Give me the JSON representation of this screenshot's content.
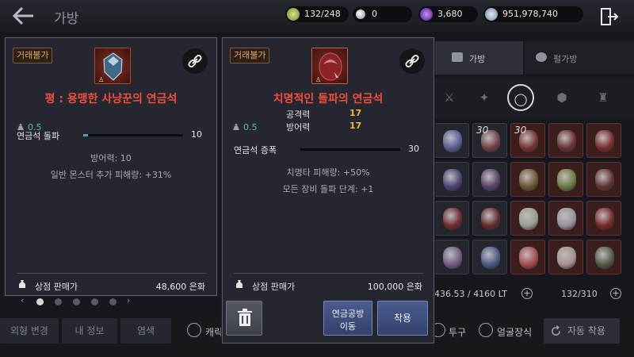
{
  "header": {
    "title": "가방",
    "currencies": {
      "weight": "132/248",
      "pearls": "0",
      "crystals": "3,680",
      "silver": "951,978,740"
    }
  },
  "background": {
    "tabs": [
      {
        "label": "가방"
      },
      {
        "label": "펄가방"
      }
    ],
    "category_icons": [
      "crossed-swords",
      "armor",
      "ring",
      "shield",
      "alchemy-stone-flask"
    ],
    "grid": {
      "stack_counts": [
        "30",
        "30"
      ],
      "gem_colors": [
        "#6c6fb8",
        "#8a4a4a",
        "#8e3a3a",
        "#7a3a3a",
        "#8c3232",
        "#5b4a8a",
        "#6a4a7a",
        "#7a6a3a",
        "#7a9a4a",
        "#6a3a3a",
        "#8a2e2e",
        "#7a2e2e",
        "#b8c8b8",
        "#b8b8c8",
        "#8a2e2e",
        "#8a6e9a",
        "#5a6aa0",
        "#c85a5a",
        "#c8b8b8",
        "#5a6a5a"
      ]
    },
    "weight_readout": "436.53 / 4160 LT",
    "slot_readout": "132/310",
    "plus_symbol": "+",
    "pager": {
      "prev": "‹",
      "next": "›",
      "count": 5,
      "active_index": 0
    }
  },
  "bottom_bar": {
    "appearance_button": "외형 변경",
    "my_info_button": "내 정보",
    "dye_button": "염색",
    "checkbox_character_label": "캐릭",
    "checkbox_helmet_label": "투구",
    "checkbox_face_label": "얼굴장식",
    "auto_equip_label": "자동 착용"
  },
  "left_panel": {
    "badge": "거래불가",
    "item_name": "평 : 용맹한 사냥꾼의 연금석",
    "weight": "0.5",
    "bar": {
      "label": "연금석 돌파",
      "value": "10",
      "fill_fraction": 0.05
    },
    "effects": [
      "방어력: 10",
      "일반 몬스터 추가 피해량: +31%"
    ],
    "sell_label": "상점 판매가",
    "sell_price": "48,600 은화"
  },
  "right_panel": {
    "badge": "거래불가",
    "item_name": "치명적인 돌파의 연금석",
    "stats": [
      {
        "label": "공격력",
        "value": "17"
      },
      {
        "label": "방어력",
        "value": "17"
      }
    ],
    "weight": "0.5",
    "bar": {
      "label": "연금석 증폭",
      "value": "30",
      "fill_fraction": 1.0
    },
    "effects": [
      "치명타 피해량: +50%",
      "모든 장비 돌파 단계: +1"
    ],
    "sell_label": "상점 판매가",
    "sell_price": "100,000 은화"
  },
  "actions": {
    "alchemy_move_line1": "연금공방",
    "alchemy_move_line2": "이동",
    "equip_button": "착용"
  },
  "colors": {
    "item_name_red": "#ef4e3f",
    "stat_gold": "#f0b93e",
    "badge_orange": "#e3a75a",
    "weight_teal": "#4ec1b1",
    "button_blue": "#3e4f80"
  }
}
